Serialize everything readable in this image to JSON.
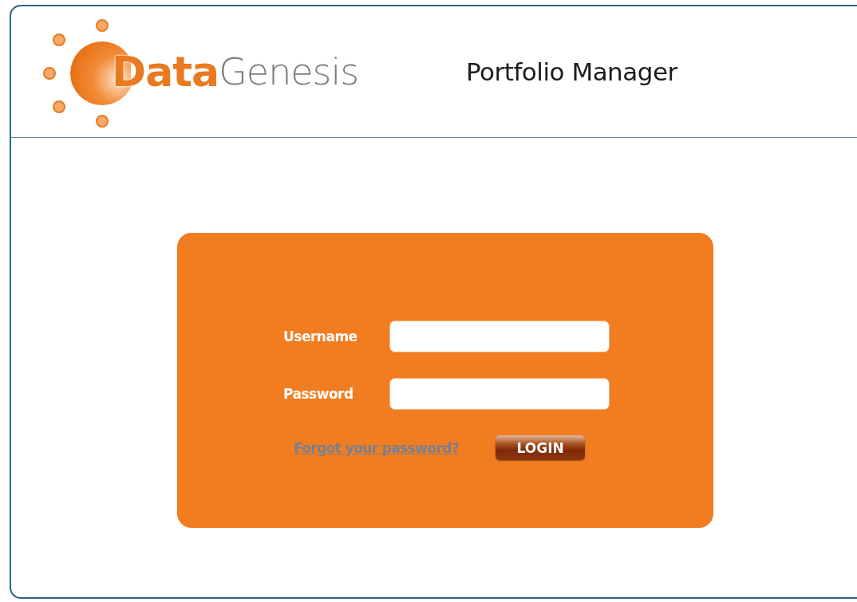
{
  "logo": {
    "bold_part": "Data",
    "light_part": "Genesis"
  },
  "header": {
    "title": "Portfolio Manager"
  },
  "login_form": {
    "fields": [
      {
        "label": "Username"
      },
      {
        "label": "Password"
      }
    ],
    "forgot_link": "Forgot your password?",
    "login_button": "LOGIN"
  }
}
